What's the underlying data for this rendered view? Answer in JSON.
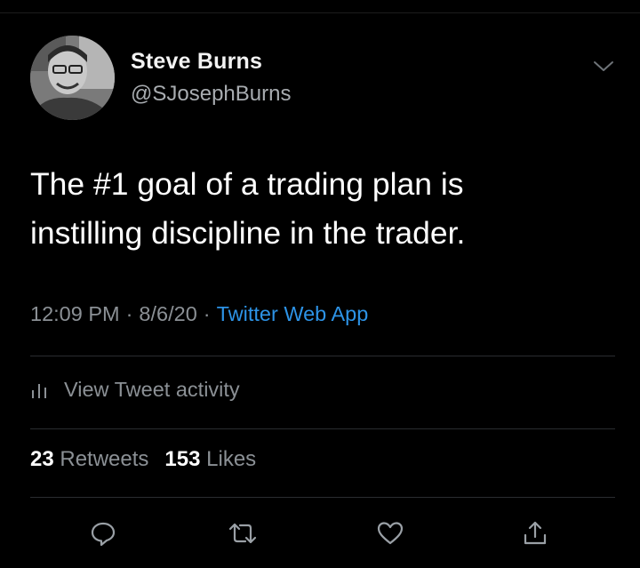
{
  "tweet": {
    "author_name": "Steve Burns",
    "author_handle": "@SJosephBurns",
    "text_line1": "The #1 goal of a trading plan is",
    "text_line2": "instilling discipline in the trader.",
    "time": "12:09 PM",
    "date": "8/6/20",
    "separator": "·",
    "source": "Twitter Web App",
    "activity_label": "View Tweet activity",
    "retweets_count": "23",
    "retweets_label": "Retweets",
    "likes_count": "153",
    "likes_label": "Likes"
  },
  "icons": {
    "more": "chevron-down-icon",
    "activity": "bar-chart-icon",
    "reply": "reply-icon",
    "retweet": "retweet-icon",
    "like": "heart-icon",
    "share": "share-icon"
  },
  "colors": {
    "background": "#000000",
    "primary_text": "#ffffff",
    "secondary_text": "#8b9095",
    "link": "#2d93e6",
    "divider": "#2a2d30"
  }
}
